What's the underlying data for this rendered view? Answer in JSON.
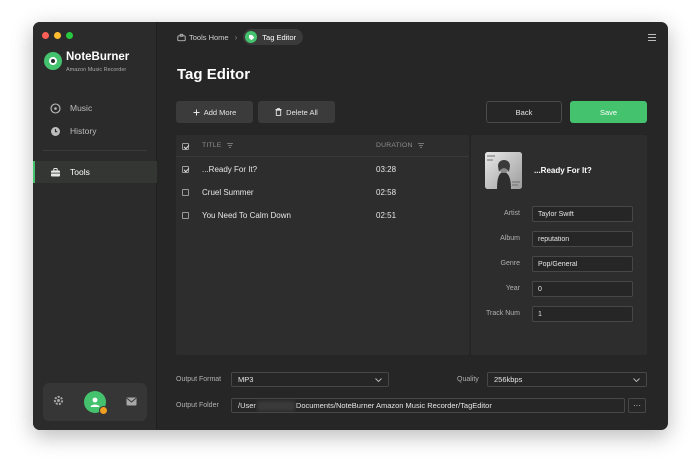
{
  "app": {
    "name": "NoteBurner",
    "subtitle": "Amazon Music Recorder"
  },
  "sidebar": {
    "items": [
      {
        "label": "Music",
        "icon": "music-note-icon"
      },
      {
        "label": "History",
        "icon": "clock-icon"
      },
      {
        "label": "Tools",
        "icon": "toolbox-icon",
        "active": true
      }
    ],
    "bottom_icons": [
      "settings-icon",
      "avatar",
      "mail-icon"
    ]
  },
  "breadcrumb": {
    "home": "Tools Home",
    "current": "Tag Editor"
  },
  "page": {
    "title": "Tag Editor"
  },
  "toolbar": {
    "add_more": "Add More",
    "delete_all": "Delete All",
    "back": "Back",
    "save": "Save"
  },
  "table": {
    "headers": {
      "title": "TITLE",
      "duration": "DURATION"
    },
    "rows": [
      {
        "title": "...Ready For It?",
        "duration": "03:28",
        "checked": true
      },
      {
        "title": "Cruel Summer",
        "duration": "02:58",
        "checked": false
      },
      {
        "title": "You Need To Calm Down",
        "duration": "02:51",
        "checked": false
      }
    ]
  },
  "detail": {
    "title": "...Ready For It?",
    "fields": {
      "artist": {
        "label": "Artist",
        "value": "Taylor Swift"
      },
      "album": {
        "label": "Album",
        "value": "reputation"
      },
      "genre": {
        "label": "Genre",
        "value": "Pop/General"
      },
      "year": {
        "label": "Year",
        "value": "0"
      },
      "track": {
        "label": "Track Num",
        "value": "1"
      }
    }
  },
  "output": {
    "format_label": "Output Format",
    "format_value": "MP3",
    "quality_label": "Quality",
    "quality_value": "256kbps",
    "folder_label": "Output Folder",
    "folder_prefix": "/User",
    "folder_suffix": "Documents/NoteBurner Amazon Music Recorder/TagEditor",
    "more_button": "···"
  },
  "colors": {
    "accent": "#45c26e",
    "window_bg": "#262626",
    "sidebar_bg": "#2b2b2b",
    "panel_bg": "#2d2d2d"
  }
}
